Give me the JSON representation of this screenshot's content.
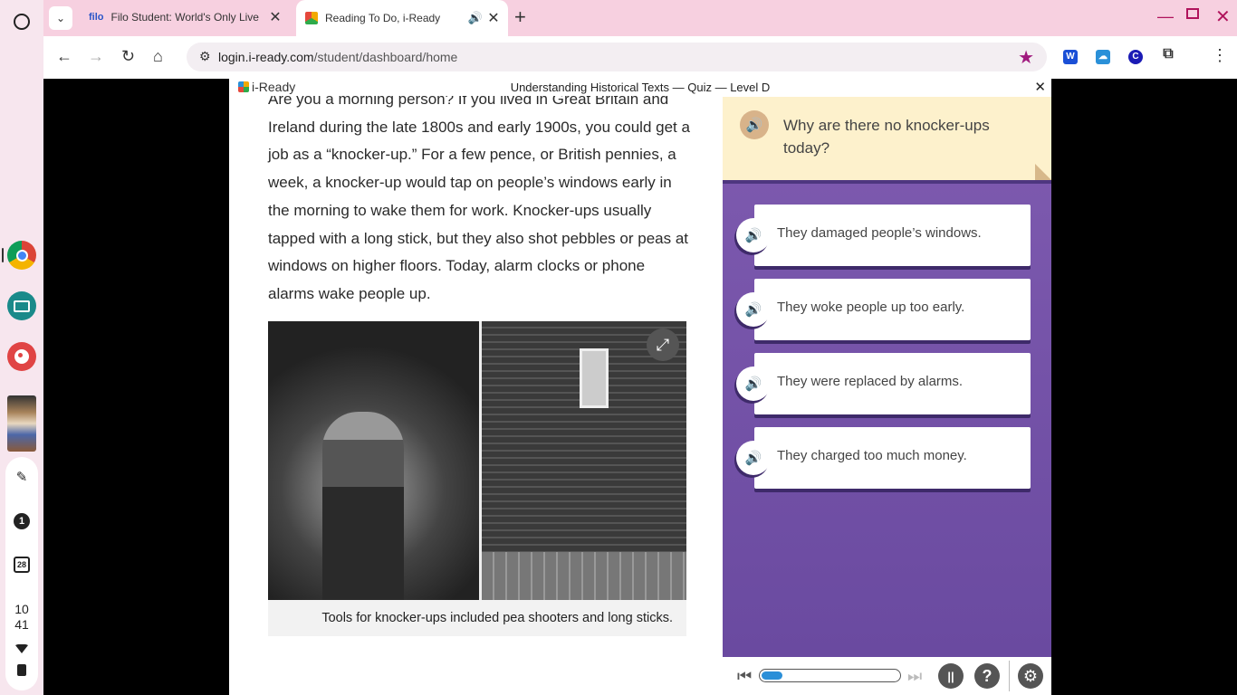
{
  "browser": {
    "tabs": [
      {
        "favicon": "filo",
        "title": "Filo Student: World's Only Live"
      },
      {
        "favicon": "iready-cube-icon",
        "title": "Reading To Do, i-Ready"
      }
    ],
    "url_host": "login.i-ready.com",
    "url_path": "/student/dashboard/home",
    "extensions": [
      "W",
      "",
      "C"
    ]
  },
  "shelf": {
    "notification_count": "1",
    "calendar_day": "28",
    "clock_hour": "10",
    "clock_minute": "41"
  },
  "lesson": {
    "brand": "i-Ready",
    "title": "Understanding Historical Texts — Quiz — Level D",
    "passage": "Are you a morning person? If you lived in Great Britain and Ireland during the late 1800s and early 1900s, you could get a job as a “knocker-up.” For a few pence, or British pennies, a week, a knocker-up would tap on people’s windows early in the morning to wake them for work. Knocker-ups usually tapped with a long stick, but they also shot pebbles or peas at windows on higher floors. Today, alarm clocks or phone alarms wake people up.",
    "caption": "Tools for knocker-ups included pea shooters and long sticks."
  },
  "question": {
    "text": "Why are there no knocker-ups today?",
    "choices": [
      {
        "label": "They damaged people’s windows."
      },
      {
        "label": "They woke people up too early."
      },
      {
        "label": "They were replaced by alarms."
      },
      {
        "label": "They charged too much money."
      }
    ]
  },
  "controls": {
    "progress": 0.15
  },
  "colors": {
    "panel_purple": "#7f5bb0",
    "question_card": "#fdf1cc",
    "progress_blue": "#2a8fd8",
    "star": "#a0197e"
  }
}
